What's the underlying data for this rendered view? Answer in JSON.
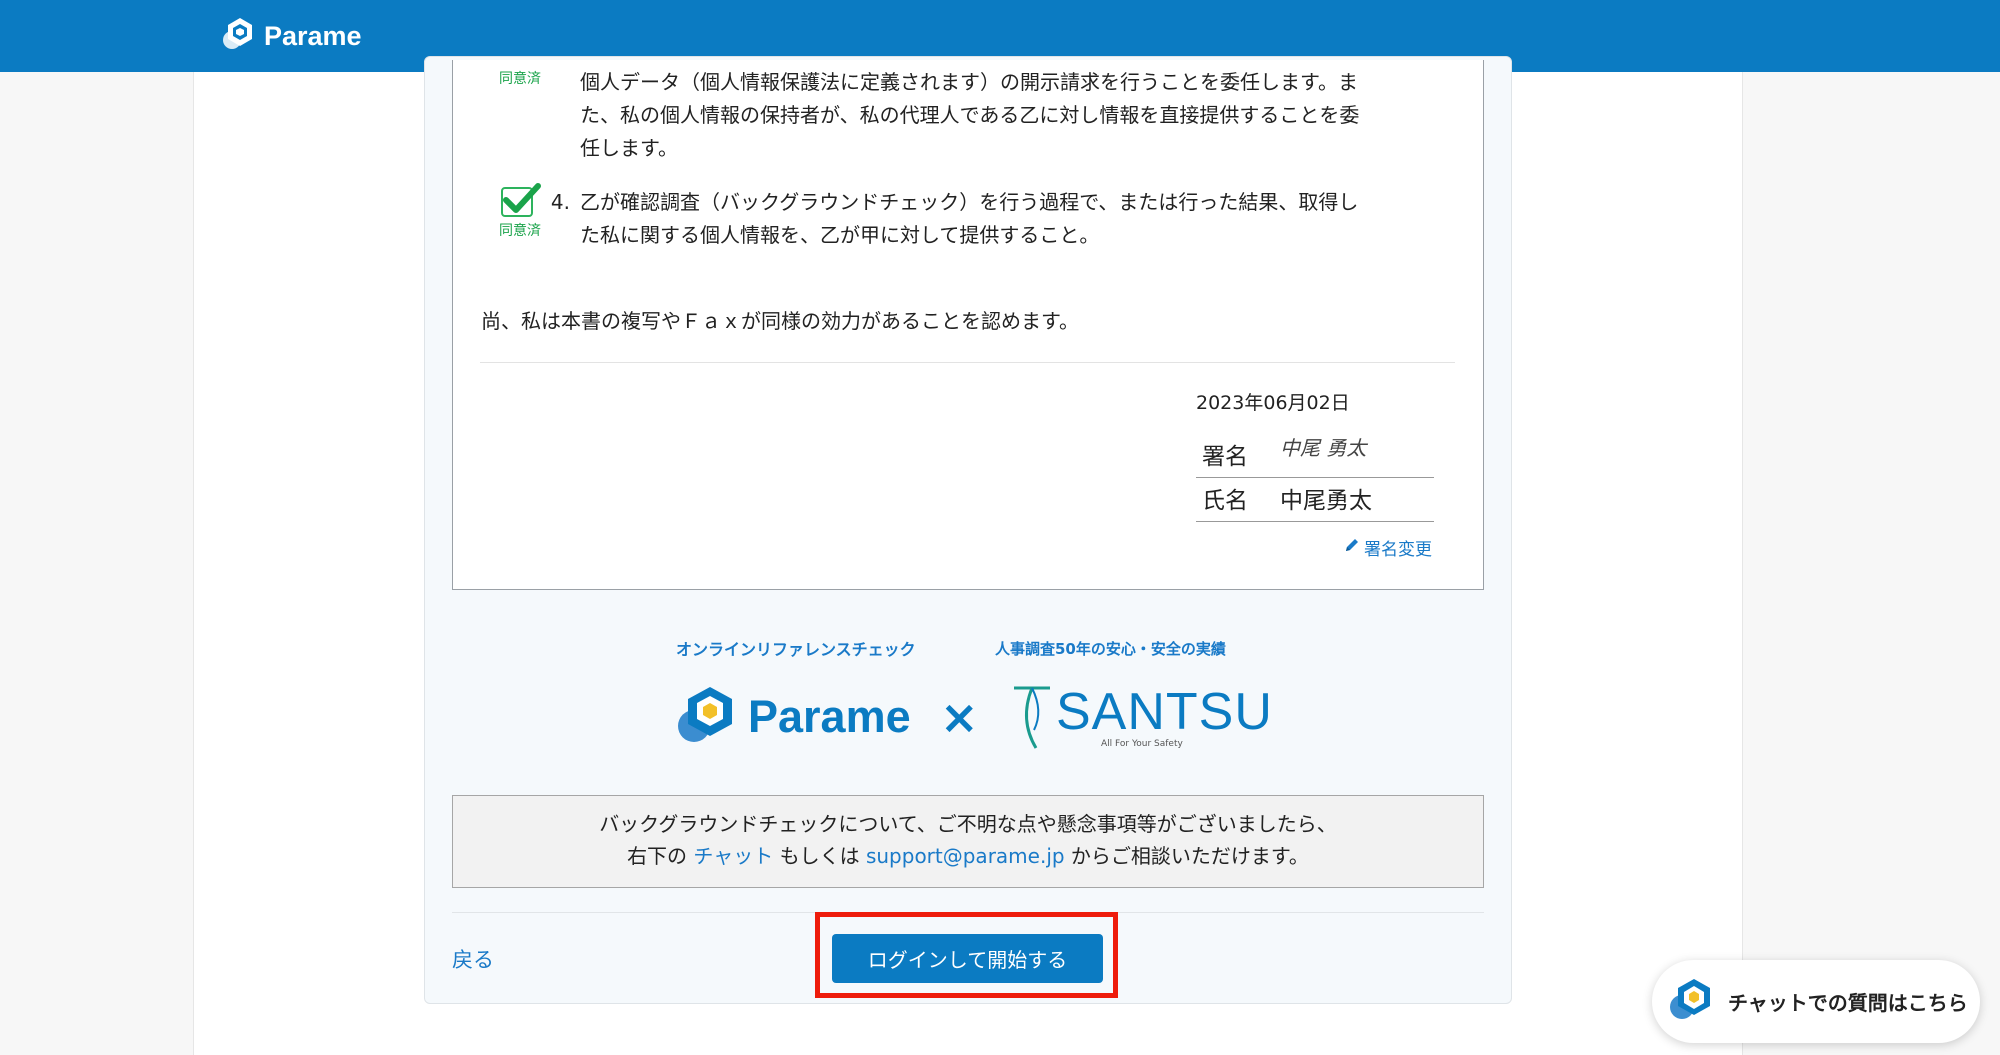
{
  "header": {
    "logo_text": "Parame"
  },
  "clauses": [
    {
      "agree_label": "同意済",
      "number": "",
      "lines": [
        "個人データ（個人情報保護法に定義されます）の開示請求を行うことを委任します。ま",
        "た、私の個人情報の保持者が、私の代理人である乙に対し情報を直接提供することを委",
        "任します。"
      ]
    },
    {
      "agree_label": "同意済",
      "number": "4.",
      "lines": [
        "乙が確認調査（バックグラウンドチェック）を行う過程で、または行った結果、取得し",
        "た私に関する個人情報を、乙が甲に対して提供すること。"
      ]
    }
  ],
  "note": "尚、私は本書の複写やＦａｘが同様の効力があることを認めます。",
  "signature": {
    "date": "2023年06月02日",
    "sign_label": "署名",
    "handwritten": "中尾 勇太",
    "name_label": "氏名",
    "name_value": "中尾勇太",
    "change_label": "署名変更"
  },
  "brand": {
    "tag_left": "オンラインリファレンスチェック",
    "tag_right": "人事調査50年の安心・安全の実績",
    "parame": "Parame",
    "times": "×",
    "santsu": "SANTSU",
    "santsu_sub": "All For Your Safety"
  },
  "info": {
    "line1": "バックグラウンドチェックについて、ご不明な点や懸念事項等がございましたら、",
    "line2_prefix": "右下の ",
    "chat_link": "チャット",
    "line2_mid": " もしくは ",
    "email_link": "support@parame.jp",
    "line2_suffix": " からご相談いただけます。"
  },
  "actions": {
    "back": "戻る",
    "start": "ログインして開始する"
  },
  "chat_widget": {
    "label": "チャットでの質問はこちら"
  },
  "colors": {
    "brand": "#0b7bc2",
    "agree": "#1aa34a",
    "highlight": "#ee1c0c"
  }
}
